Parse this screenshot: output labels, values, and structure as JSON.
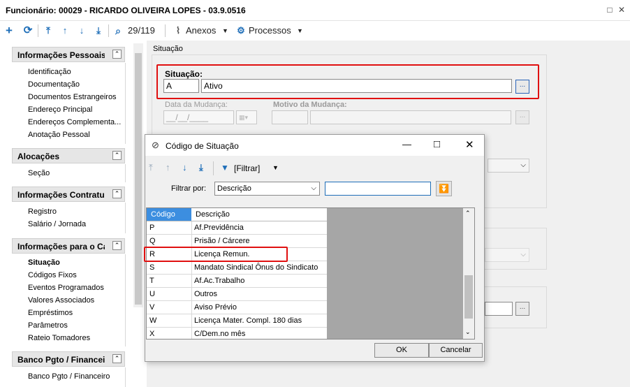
{
  "window": {
    "title": "Funcionário: 00029 - RICARDO OLIVEIRA LOPES - 03.9.0516"
  },
  "toolbar": {
    "counter": "29/119",
    "anexos": "Anexos",
    "processos": "Processos"
  },
  "sidebar": {
    "sections": [
      {
        "title": "Informações Pessoais",
        "items": [
          "Identificação",
          "Documentação",
          "Documentos Estrangeiros",
          "Endereço Principal",
          "Endereços Complementa...",
          "Anotação Pessoal"
        ]
      },
      {
        "title": "Alocações",
        "items": [
          "Seção"
        ]
      },
      {
        "title": "Informações Contratuais",
        "items": [
          "Registro",
          "Salário / Jornada"
        ]
      },
      {
        "title": "Informações para o Cálculo",
        "items": [
          "Situação",
          "Códigos Fixos",
          "Eventos Programados",
          "Valores Associados",
          "Empréstimos",
          "Parâmetros",
          "Rateio Tomadores"
        ]
      },
      {
        "title": "Banco Pgto / Financeiro",
        "items": [
          "Banco Pgto / Financeiro"
        ]
      }
    ]
  },
  "main": {
    "group_title": "Situação",
    "situacao_label": "Situação:",
    "situacao_code": "A",
    "situacao_desc": "Ativo",
    "lookup_btn": "...",
    "data_mudanca_label": "Data da Mudança:",
    "data_mudanca_value": "__/__/____",
    "motivo_label": "Motivo da Mudança:"
  },
  "dialog": {
    "title": "Código de Situação",
    "filtrar_btn": "[Filtrar]",
    "filtrar_por_label": "Filtrar por:",
    "filtrar_por_value": "Descrição",
    "filter_text": "",
    "columns": [
      "Código",
      "Descrição"
    ],
    "rows": [
      {
        "code": "P",
        "desc": "Af.Previdência"
      },
      {
        "code": "Q",
        "desc": "Prisão / Cárcere"
      },
      {
        "code": "R",
        "desc": "Licença Remun."
      },
      {
        "code": "S",
        "desc": "Mandato Sindical Ônus do Sindicato"
      },
      {
        "code": "T",
        "desc": "Af.Ac.Trabalho"
      },
      {
        "code": "U",
        "desc": "Outros"
      },
      {
        "code": "V",
        "desc": "Aviso Prévio"
      },
      {
        "code": "W",
        "desc": "Licença Mater. Compl. 180 dias"
      },
      {
        "code": "X",
        "desc": "C/Dem.no mês"
      }
    ],
    "ok": "OK",
    "cancel": "Cancelar"
  },
  "colors": {
    "accent": "#1e6eb8",
    "highlight": "#e01010",
    "header_selected": "#3c8ee0"
  }
}
